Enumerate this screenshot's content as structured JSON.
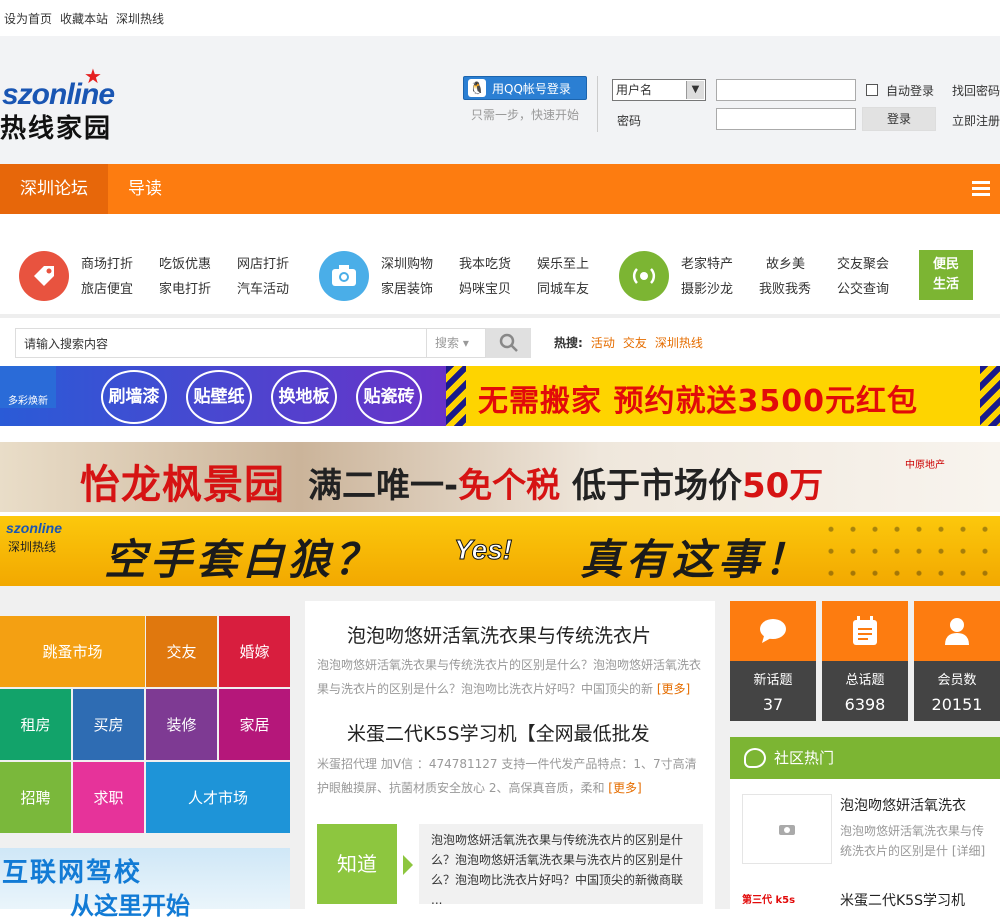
{
  "topbar": {
    "links": [
      "设为首页",
      "收藏本站",
      "深圳热线"
    ]
  },
  "logo": {
    "en": "szonline",
    "cn": "热线家园"
  },
  "login": {
    "qq_button": "用QQ帐号登录",
    "qq_hint": "只需一步，快速开始",
    "username_select": "用户名",
    "password_label": "密码",
    "auto_login": "自动登录",
    "login_button": "登录",
    "find_password": "找回密码",
    "register": "立即注册"
  },
  "nav": {
    "items": [
      "深圳论坛",
      "导读"
    ]
  },
  "categories": {
    "group1": [
      "商场打折",
      "吃饭优惠",
      "网店打折",
      "旅店便宜",
      "家电打折",
      "汽车活动"
    ],
    "group2": [
      "深圳购物",
      "我本吃货",
      "娱乐至上",
      "家居装饰",
      "妈咪宝贝",
      "同城车友"
    ],
    "group3": [
      "老家特产",
      "故乡美",
      "交友聚会",
      "摄影沙龙",
      "我败我秀",
      "公交查询"
    ],
    "convenience": "便民生活",
    "colors": {
      "red": "#e8533f",
      "blue": "#4aaee8",
      "green": "#7cb533"
    }
  },
  "search": {
    "placeholder": "请输入搜索内容",
    "type": "搜索",
    "hot_label": "热搜:",
    "hot": [
      "活动",
      "交友",
      "深圳热线"
    ]
  },
  "banners": {
    "b1_logo": "多彩焕新",
    "b1_pills": [
      "刷墙漆",
      "贴壁纸",
      "换地板",
      "贴瓷砖"
    ],
    "b1_text": "无需搬家 预约就送3500元红包",
    "b2_title": "怡龙枫景园",
    "b2_text_a": "满二唯一",
    "b2_text_b": "免个税",
    "b2_text_c": "低于市场价",
    "b2_text_d": "50万",
    "b2_badge": "中原地产",
    "b3_logo": "szonline",
    "b3_logo2": "深圳热线",
    "b3_text": "空手套白狼？",
    "b3_yes": "Yes!",
    "b3_text2": "真有这事！"
  },
  "tiles": [
    {
      "label": "跳蚤市场",
      "color": "#f4a012"
    },
    {
      "label": "交友",
      "color": "#e0780e"
    },
    {
      "label": "婚嫁",
      "color": "#d81e3e"
    },
    {
      "label": "租房",
      "color": "#12a36a"
    },
    {
      "label": "买房",
      "color": "#2e6cb3"
    },
    {
      "label": "装修",
      "color": "#7e3a93"
    },
    {
      "label": "家居",
      "color": "#b5177a"
    },
    {
      "label": "招聘",
      "color": "#7ab83b"
    },
    {
      "label": "求职",
      "color": "#e6339a"
    },
    {
      "label": "人才市场",
      "color": "#1e94d8"
    }
  ],
  "ad_bottom": {
    "line1": "互联网驾校",
    "line2": "从这里开始"
  },
  "articles": [
    {
      "title": "泡泡吻悠妍活氧洗衣果与传统洗衣片",
      "text": "泡泡吻悠妍活氧洗衣果与传统洗衣片的区别是什么？泡泡吻悠妍活氧洗衣果与洗衣片的区别是什么？泡泡吻比洗衣片好吗？中国顶尖的新",
      "more": "[更多]"
    },
    {
      "title": "米蛋二代K5S学习机【全网最低批发",
      "text": "米蛋招代理 加V信 ：474781127 支持一件代发产品特点：1、7寸高清护眼触摸屏、抗菌材质安全放心 2、高保真音质，柔和",
      "more": "[更多]"
    }
  ],
  "zhidao": {
    "label": "知道",
    "text": "泡泡吻悠妍活氧洗衣果与传统洗衣片的区别是什么？泡泡吻悠妍活氧洗衣果与洗衣片的区别是什么？泡泡吻比洗衣片好吗？中国顶尖的新微商联 ..."
  },
  "stats": [
    {
      "label": "新话题",
      "value": "37",
      "icon": "chat-bubble-icon"
    },
    {
      "label": "总话题",
      "value": "6398",
      "icon": "notepad-icon"
    },
    {
      "label": "会员数",
      "value": "20151",
      "icon": "user-icon"
    }
  ],
  "community": {
    "header": "社区热门",
    "item1_title": "泡泡吻悠妍活氧洗衣",
    "item1_text": "泡泡吻悠妍活氧洗衣果与传统洗衣片的区别是什",
    "item1_more": "[详细]",
    "item2_title": "米蛋二代K5S学习机",
    "item2_thumb": "第三代 k5s"
  }
}
